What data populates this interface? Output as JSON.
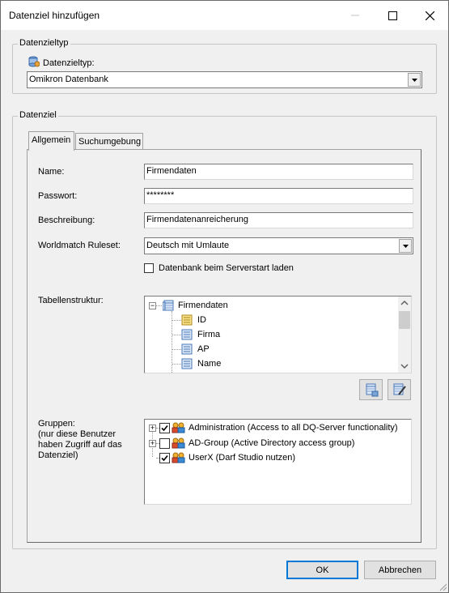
{
  "window": {
    "title": "Datenziel hinzufügen"
  },
  "group_type": {
    "legend": "Datenzieltyp",
    "label": "Datenzieltyp:",
    "selected": "Omikron Datenbank"
  },
  "group_target": {
    "legend": "Datenziel",
    "tabs": [
      {
        "label": "Allgemein"
      },
      {
        "label": "Suchumgebung"
      }
    ],
    "fields": {
      "name_label": "Name:",
      "name_value": "Firmendaten",
      "password_label": "Passwort:",
      "password_value": "********",
      "description_label": "Beschreibung:",
      "description_value": "Firmendatenanreicherung",
      "ruleset_label": "Worldmatch Ruleset:",
      "ruleset_value": "Deutsch mit Umlaute",
      "load_on_start_label": "Datenbank beim Serverstart laden",
      "table_structure_label": "Tabellenstruktur:",
      "groups_label_1": "Gruppen:",
      "groups_label_2": "(nur diese Benutzer",
      "groups_label_3": "haben Zugriff auf das",
      "groups_label_4": "Datenziel)"
    },
    "table_tree": {
      "root": "Firmendaten",
      "children": [
        "ID",
        "Firma",
        "AP",
        "Name"
      ]
    },
    "groups": [
      {
        "label": "Administration (Access to all DQ-Server functionality)",
        "checked": true
      },
      {
        "label": "AD-Group (Active Directory access group)",
        "checked": false
      },
      {
        "label": "UserX (Darf Studio nutzen)",
        "checked": true
      }
    ]
  },
  "buttons": {
    "ok": "OK",
    "cancel": "Abbrechen"
  },
  "icons": [
    "database-icon",
    "table-icon",
    "key-field-icon",
    "field-icon",
    "group-icon",
    "add-table-icon",
    "edit-table-icon"
  ]
}
